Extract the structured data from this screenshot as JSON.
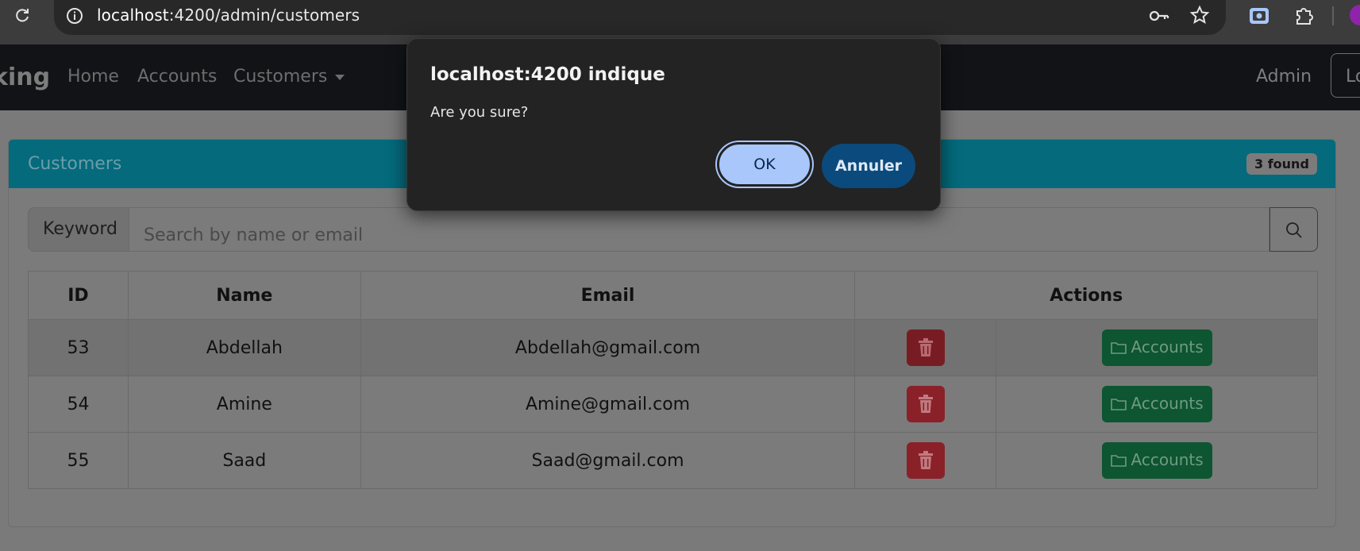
{
  "browser": {
    "url_host": "localhost",
    "url_rest": ":4200/admin/customers"
  },
  "navbar": {
    "brand": "king",
    "links": [
      "Home",
      "Accounts",
      "Customers"
    ],
    "user": "Admin",
    "logout": "Lo"
  },
  "card": {
    "title": "Customers",
    "badge": "3 found"
  },
  "search": {
    "label": "Keyword",
    "placeholder": "Search by name or email"
  },
  "table": {
    "headers": [
      "ID",
      "Name",
      "Email",
      "Actions"
    ],
    "rows": [
      {
        "id": "53",
        "name": "Abdellah",
        "email": "Abdellah@gmail.com",
        "action": "Accounts"
      },
      {
        "id": "54",
        "name": "Amine",
        "email": "Amine@gmail.com",
        "action": "Accounts"
      },
      {
        "id": "55",
        "name": "Saad",
        "email": "Saad@gmail.com",
        "action": "Accounts"
      }
    ]
  },
  "dialog": {
    "title": "localhost:4200 indique",
    "message": "Are you sure?",
    "ok": "OK",
    "cancel": "Annuler"
  },
  "colors": {
    "card_header": "#046a7c",
    "delete_button": "#8a2129",
    "accounts_button": "#0e5532",
    "ok_button": "#a9c7fa",
    "cancel_button": "#0b4a7c"
  }
}
